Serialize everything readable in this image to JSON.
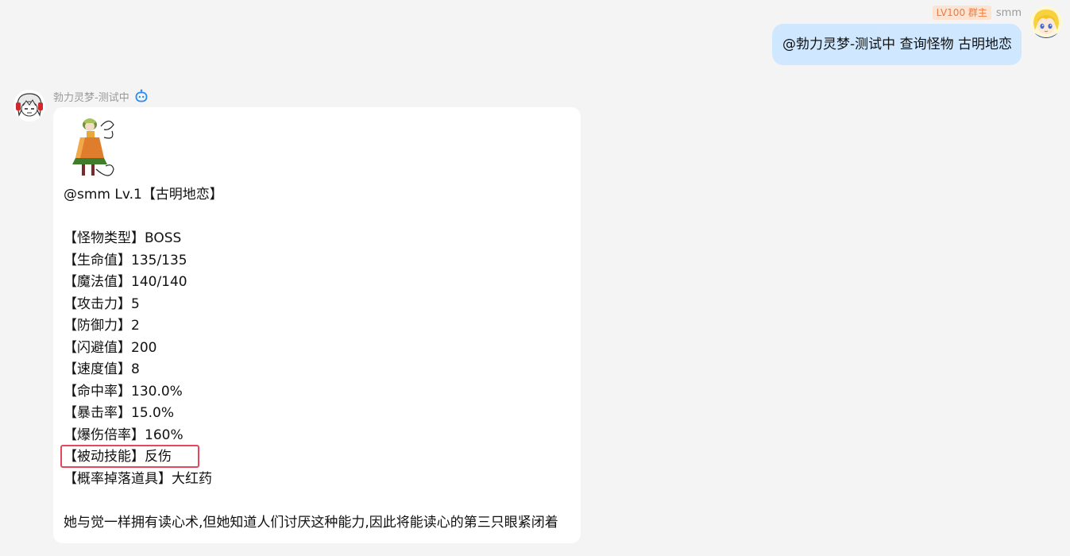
{
  "outgoing": {
    "badge": "LV100 群主",
    "sender": "smm",
    "text": "@勃力灵梦-测试中 查询怪物 古明地恋",
    "avatar_icon": "blonde-character-avatar"
  },
  "incoming": {
    "sender": "勃力灵梦-测试中",
    "bot_badge_icon": "robot-icon",
    "avatar_icon": "white-haired-character-avatar",
    "sprite_icon": "koishi-sprite",
    "lines": [
      "@smm Lv.1【古明地恋】",
      "",
      "【怪物类型】BOSS",
      "【生命值】135/135",
      "【魔法值】140/140",
      "【攻击力】5",
      "【防御力】2",
      "【闪避值】200",
      "【速度值】8",
      "【命中率】130.0%",
      "【暴击率】15.0%",
      "【爆伤倍率】160%",
      "【被动技能】反伤",
      "【概率掉落道具】大红药"
    ],
    "description": "她与觉一样拥有读心术,但她知道人们讨厌这种能力,因此将能读心的第三只眼紧闭着"
  },
  "colors": {
    "background": "#f4f4f4",
    "outgoing_bubble": "#cfe8ff",
    "incoming_bubble": "#ffffff",
    "badge_bg": "#fde3d2",
    "badge_text": "#f07b3f",
    "highlight": "#e8465a",
    "bot_icon": "#2a8cf0"
  }
}
